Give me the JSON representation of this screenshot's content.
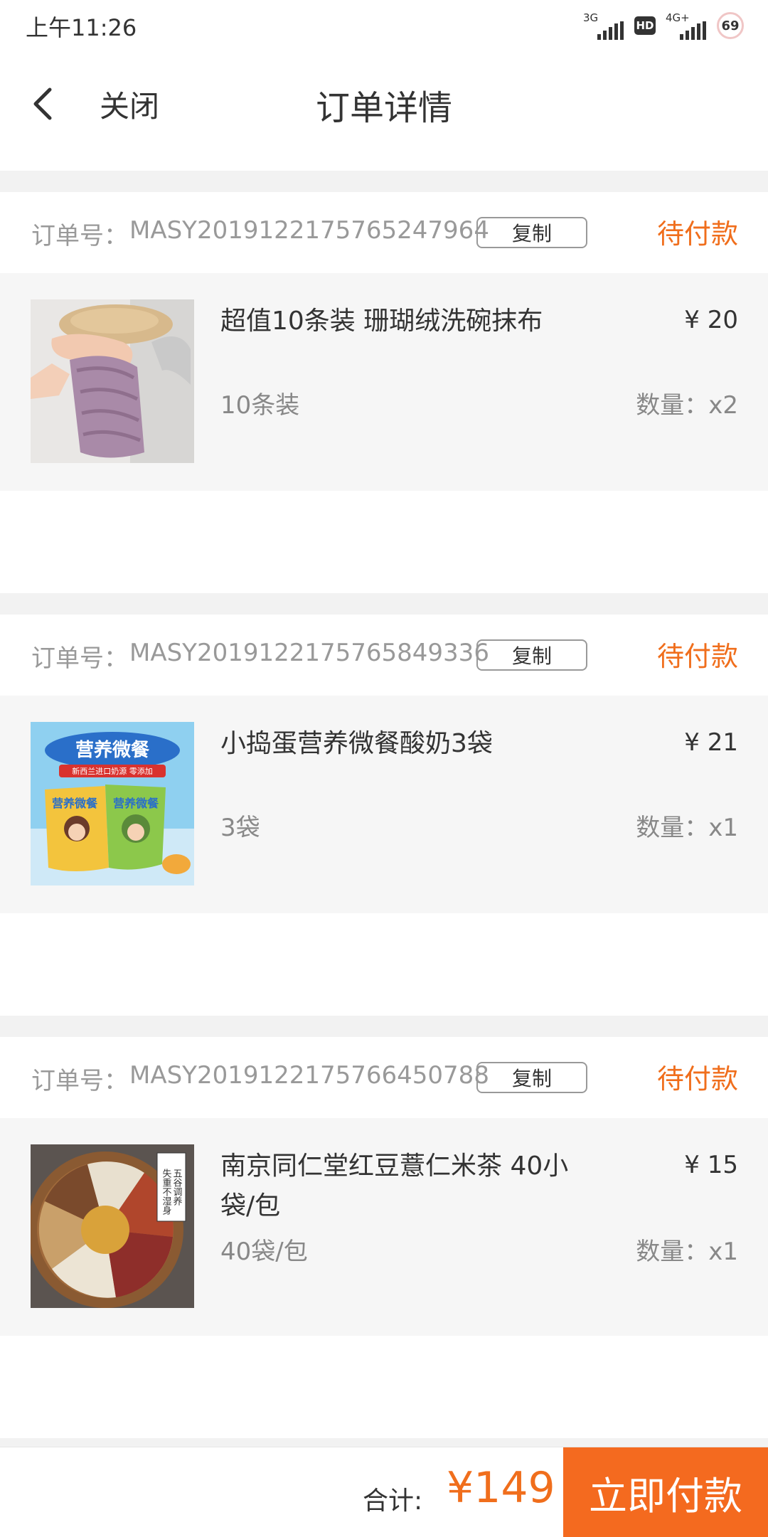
{
  "status_bar": {
    "time": "上午11:26",
    "net1_label": "3G",
    "hd_label": "HD",
    "net2_label": "4G+",
    "battery": "69"
  },
  "header": {
    "close_label": "关闭",
    "title": "订单详情"
  },
  "orders": [
    {
      "order_no_label": "订单号：",
      "order_no": "MASY2019122175765247964",
      "copy_label": "复制",
      "status": "待付款",
      "product_name": "超值10条装 珊瑚绒洗碗抹布",
      "price": "¥ 20",
      "spec": "10条装",
      "quantity": "数量：x2"
    },
    {
      "order_no_label": "订单号：",
      "order_no": "MASY2019122175765849336",
      "copy_label": "复制",
      "status": "待付款",
      "product_name": "小捣蛋营养微餐酸奶3袋",
      "price": "¥ 21",
      "spec": "3袋",
      "quantity": "数量：x1",
      "image_text": {
        "headline": "营养微餐",
        "subline": "新西兰进口奶源 零添加",
        "pack1": "营养微餐",
        "pack2": "营养微餐"
      }
    },
    {
      "order_no_label": "订单号：",
      "order_no": "MASY2019122175766450788",
      "copy_label": "复制",
      "status": "待付款",
      "product_name": "南京同仁堂红豆薏仁米茶 40小袋/包",
      "price": "¥ 15",
      "spec": "40袋/包",
      "quantity": "数量：x1",
      "image_text": {
        "tag_line1": "五谷调养",
        "tag_line2": "失重不湿身"
      }
    }
  ],
  "footer": {
    "total_label": "合计:",
    "total_amount": "¥149",
    "pay_label": "立即付款"
  },
  "colors": {
    "accent": "#f46a1f",
    "status_text": "#f06e1c",
    "page_gap": "#f2f2f2",
    "card_body": "#f6f6f6"
  }
}
